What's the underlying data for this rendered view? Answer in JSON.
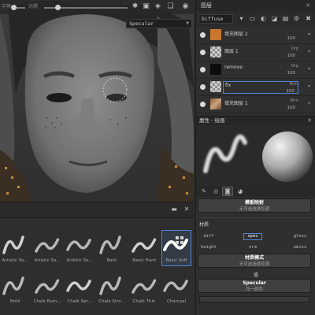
{
  "viewport": {
    "top_label_1": "中等",
    "top_label_2": "光照",
    "channel_select": "Specular",
    "icons": [
      "settings-icon",
      "camera-icon",
      "cube-icon",
      "stack-icon",
      "screenshot-icon"
    ]
  },
  "shelf": {
    "brushes": [
      {
        "name": "Artistic So...",
        "selected": false
      },
      {
        "name": "Artistic So...",
        "selected": false
      },
      {
        "name": "Artistic So...",
        "selected": false
      },
      {
        "name": "Bark",
        "selected": false
      },
      {
        "name": "Basic Hard",
        "selected": false
      },
      {
        "name": "Basic Soft",
        "selected": true
      },
      {
        "name": "Bold",
        "selected": false
      },
      {
        "name": "Chalk Bum...",
        "selected": false
      },
      {
        "name": "Chalk Spr...",
        "selected": false
      },
      {
        "name": "Chalk Stro...",
        "selected": false
      },
      {
        "name": "Chalk Thin",
        "selected": false
      },
      {
        "name": "Charcoal",
        "selected": false
      }
    ]
  },
  "layers": {
    "title": "图层",
    "material_select": "Diffuse",
    "rows": [
      {
        "name": "填充图层 2",
        "blend": "",
        "opacity": "100",
        "thumb": "orange"
      },
      {
        "name": "图层 1",
        "blend": "Drp",
        "opacity": "100",
        "thumb": "checker"
      },
      {
        "name": "remove",
        "blend": "Drp",
        "opacity": "100",
        "thumb": "black"
      },
      {
        "name": "fix",
        "blend": "Nrm",
        "opacity": "100",
        "thumb": "checker"
      },
      {
        "name": "填充图层 1",
        "blend": "Nrm",
        "opacity": "100",
        "thumb": "texture"
      }
    ]
  },
  "properties": {
    "title": "属性 - 绘画",
    "tabs": [
      "brush-tab-icon",
      "sphere-tab-icon",
      "square-tab-icon",
      "pie-tab-icon"
    ],
    "projection_title": "模板映射",
    "projection_sub": "无可选选择您源",
    "material_label": "材质",
    "channels": [
      "diff",
      "spec",
      "gloss",
      "height",
      "nrm",
      "emiss"
    ],
    "active_channel": "spec",
    "mode_title": "材质模式",
    "mode_sub": "无可选选择您源",
    "value_label": "值",
    "specular_title": "Specular",
    "specular_sub": "均一颜色"
  },
  "colors": {
    "accent": "#4f84d8",
    "panel_bg": "#2f2f2f",
    "viewport_bg": "#353535"
  }
}
